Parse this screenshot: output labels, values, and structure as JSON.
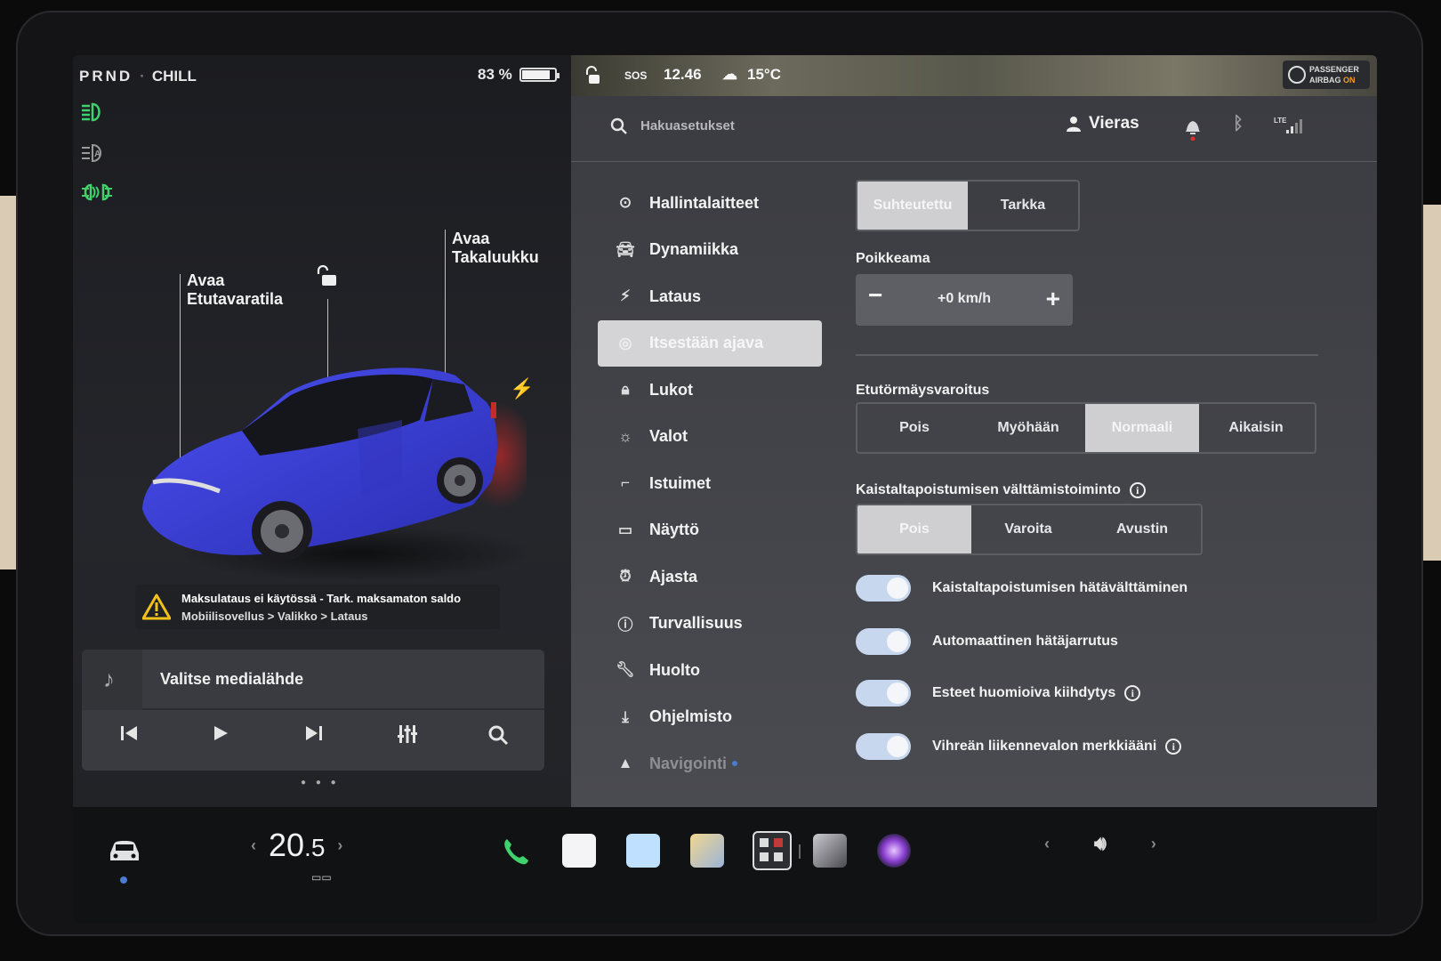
{
  "left_panel": {
    "gear": "PRND",
    "drive_mode": "CHILL",
    "battery_percent": "83 %",
    "battery_level": 0.83,
    "light_icons": [
      "headlights-on-icon",
      "auto-highbeam-icon",
      "fog-lights-icon"
    ],
    "callout_front": "Avaa\nEtutavaratila",
    "callout_trunk": "Avaa\nTakaluukku",
    "car_color": "#3b3fd6",
    "alert": {
      "line1": "Maksulataus ei käytössä - Tark. maksamaton saldo",
      "line2": "Mobiilisovellus > Valikko > Lataus"
    },
    "media": {
      "source_label": "Valitse medialähde",
      "controls": [
        "previous-icon",
        "play-icon",
        "next-icon",
        "equalizer-icon",
        "search-icon"
      ]
    }
  },
  "status_bar": {
    "range": "SOS",
    "time": "12.46",
    "temperature": "15°C",
    "airbag_line1": "PASSENGER",
    "airbag_line2": "AIRBAG",
    "airbag_status": "ON"
  },
  "header": {
    "search_placeholder": "Hakuasetukset",
    "user_name": "Vieras",
    "lte_label": "LTE"
  },
  "nav": {
    "items": [
      {
        "label": "Hallintalaitteet",
        "icon": "toggle-icon"
      },
      {
        "label": "Dynamiikka",
        "icon": "car-icon"
      },
      {
        "label": "Lataus",
        "icon": "bolt-icon"
      },
      {
        "label": "Itsestään ajava",
        "icon": "steering-wheel-icon",
        "active": true
      },
      {
        "label": "Lukot",
        "icon": "lock-icon"
      },
      {
        "label": "Valot",
        "icon": "sun-icon"
      },
      {
        "label": "Istuimet",
        "icon": "seat-icon"
      },
      {
        "label": "Näyttö",
        "icon": "display-icon"
      },
      {
        "label": "Ajasta",
        "icon": "alarm-clock-icon"
      },
      {
        "label": "Turvallisuus",
        "icon": "info-circle-icon"
      },
      {
        "label": "Huolto",
        "icon": "wrench-icon"
      },
      {
        "label": "Ohjelmisto",
        "icon": "download-icon"
      },
      {
        "label": "Navigointi",
        "icon": "navigation-icon"
      }
    ]
  },
  "settings": {
    "speed_mode": {
      "options": [
        "Suhteutettu",
        "Tarkka"
      ],
      "selected": "Suhteutettu"
    },
    "offset_label": "Poikkeama",
    "offset_value": "+0 km/h",
    "fcw_label": "Etutörmäysvaroitus",
    "fcw": {
      "options": [
        "Pois",
        "Myöhään",
        "Normaali",
        "Aikaisin"
      ],
      "selected": "Normaali"
    },
    "lda_label": "Kaistaltapoistumisen välttämistoiminto",
    "lda": {
      "options": [
        "Pois",
        "Varoita",
        "Avustin"
      ],
      "selected": "Pois"
    },
    "toggles": [
      {
        "label": "Kaistaltapoistumisen hätävälttäminen",
        "on": true,
        "info": false
      },
      {
        "label": "Automaattinen hätäjarrutus",
        "on": true,
        "info": false
      },
      {
        "label": "Esteet huomioiva kiihdytys",
        "on": true,
        "info": true
      },
      {
        "label": "Vihreän liikennevalon merkkiääni",
        "on": true,
        "info": true
      }
    ]
  },
  "dock": {
    "temperature_int": "20",
    "temperature_dec": ".5",
    "apps": [
      "phone-icon",
      "calendar-icon",
      "toybox-icon",
      "photos-icon",
      "dashcam-icon",
      "browser-icon",
      "camera-icon"
    ]
  }
}
